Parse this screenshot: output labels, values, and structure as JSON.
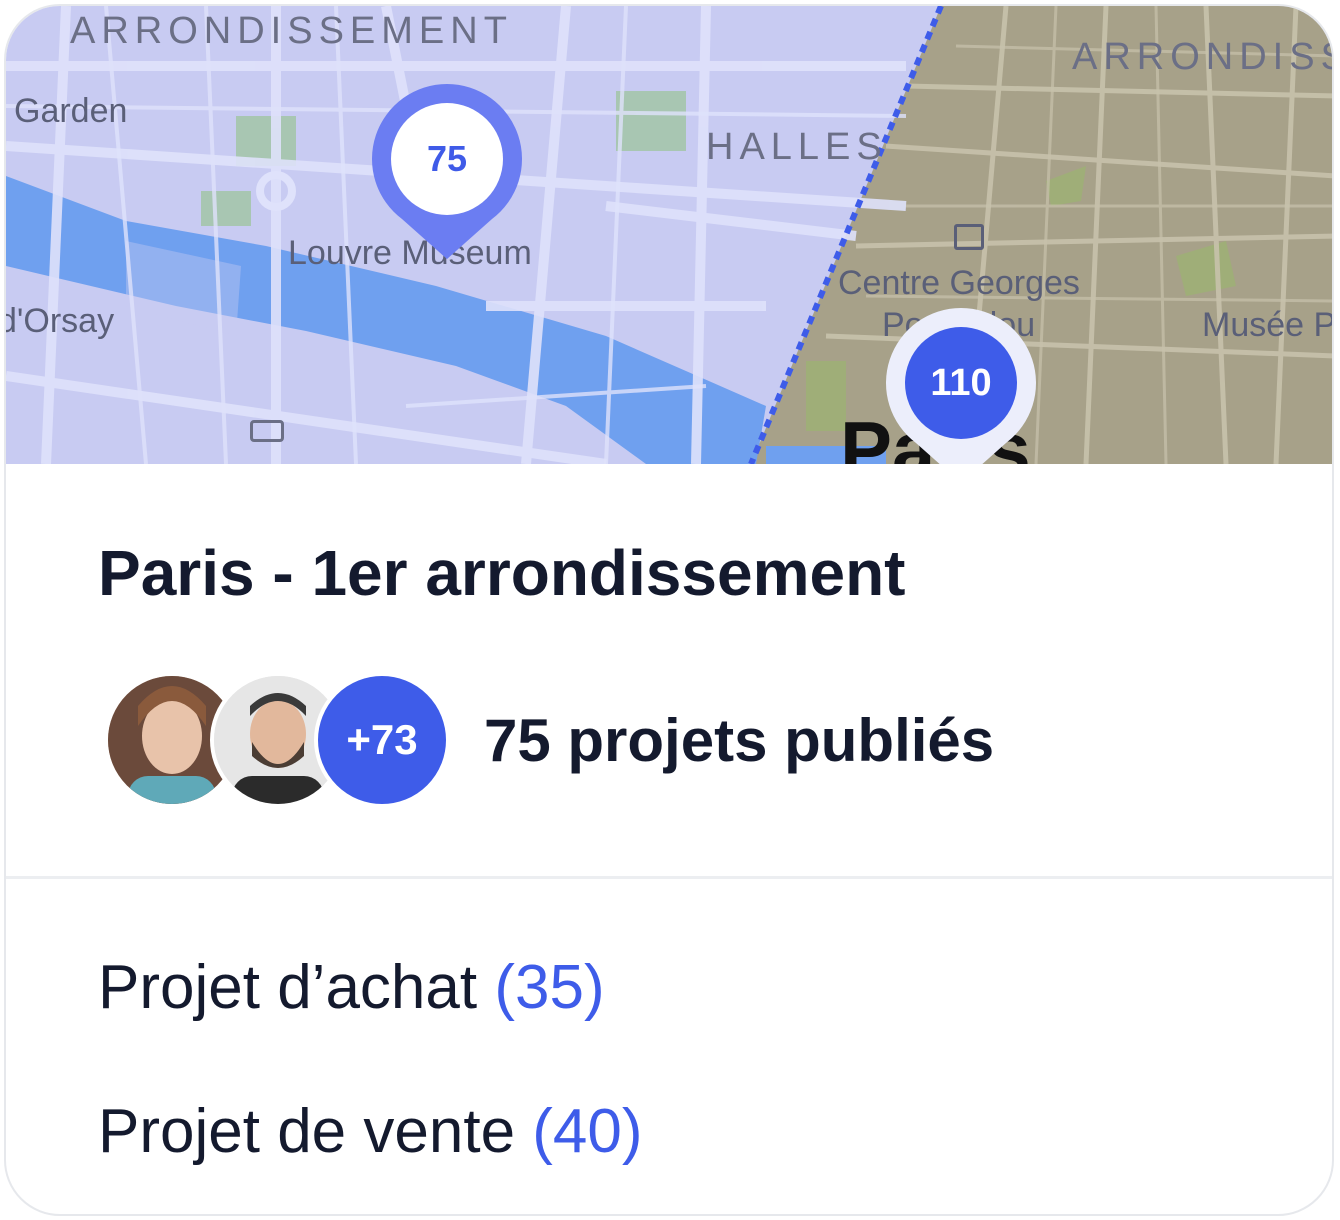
{
  "map": {
    "labels": {
      "arrondissement_left": "ARRONDISSEMENT",
      "arrondissement_right": "ARRONDISS",
      "garden": "Garden",
      "halles": "HALLES",
      "louvre": "Louvre Museum",
      "orsay": "d'Orsay",
      "centre_line1": "Centre Georges",
      "centre_line2": "Pompidou",
      "musee": "Musée P",
      "city": "Paris"
    },
    "pins": {
      "pin_75": "75",
      "pin_110": "110"
    },
    "colors": {
      "left_zone": "#c6c9f0",
      "right_zone": "#a39e86",
      "river": "#6f9eef",
      "accent": "#3e5ce9"
    }
  },
  "card": {
    "title": "Paris - 1er arrondissement",
    "avatars_more": "+73",
    "projects_count_label": "75 projets publiés",
    "projects": [
      {
        "label": "Projet d’achat",
        "count": "(35)"
      },
      {
        "label": "Projet de vente",
        "count": "(40)"
      }
    ]
  }
}
